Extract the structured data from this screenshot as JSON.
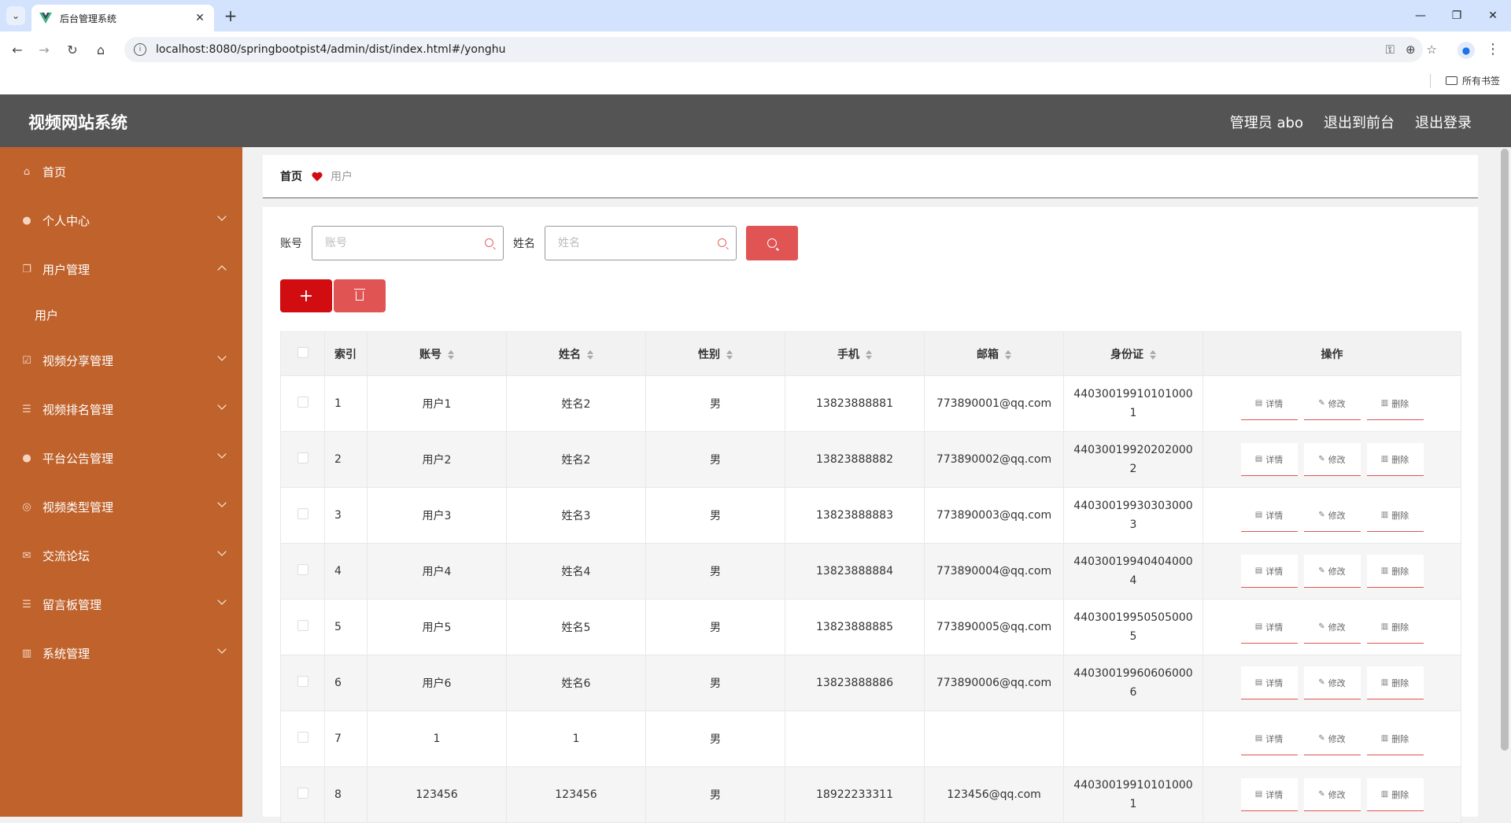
{
  "browser": {
    "tab_title": "后台管理系统",
    "url": "localhost:8080/springbootpist4/admin/dist/index.html#/yonghu",
    "bookmarks_label": "所有书签"
  },
  "header": {
    "title": "视频网站系统",
    "admin_label": "管理员 abo",
    "exit_front_label": "退出到前台",
    "logout_label": "退出登录"
  },
  "sidebar": {
    "items": [
      {
        "label": "首页",
        "icon": "home-icon"
      },
      {
        "label": "个人中心",
        "icon": "user-icon"
      },
      {
        "label": "用户管理",
        "icon": "document-icon"
      },
      {
        "label": "用户",
        "icon": ""
      },
      {
        "label": "视频分享管理",
        "icon": "checkbox-icon"
      },
      {
        "label": "视频排名管理",
        "icon": "list-icon"
      },
      {
        "label": "平台公告管理",
        "icon": "location-icon"
      },
      {
        "label": "视频类型管理",
        "icon": "settings-icon"
      },
      {
        "label": "交流论坛",
        "icon": "mail-icon"
      },
      {
        "label": "留言板管理",
        "icon": "sliders-icon"
      },
      {
        "label": "系统管理",
        "icon": "chart-icon"
      }
    ]
  },
  "breadcrumb": {
    "home": "首页",
    "current": "用户"
  },
  "search": {
    "account_label": "账号",
    "account_placeholder": "账号",
    "name_label": "姓名",
    "name_placeholder": "姓名"
  },
  "table": {
    "headers": [
      "索引",
      "账号",
      "姓名",
      "性别",
      "手机",
      "邮箱",
      "身份证",
      "操作"
    ],
    "op_labels": {
      "detail": "详情",
      "edit": "修改",
      "delete": "删除"
    },
    "rows": [
      {
        "index": "1",
        "account": "用户1",
        "name": "姓名2",
        "gender": "男",
        "phone": "13823888881",
        "email": "773890001@qq.com",
        "idcard": "440300199101010001"
      },
      {
        "index": "2",
        "account": "用户2",
        "name": "姓名2",
        "gender": "男",
        "phone": "13823888882",
        "email": "773890002@qq.com",
        "idcard": "440300199202020002"
      },
      {
        "index": "3",
        "account": "用户3",
        "name": "姓名3",
        "gender": "男",
        "phone": "13823888883",
        "email": "773890003@qq.com",
        "idcard": "440300199303030003"
      },
      {
        "index": "4",
        "account": "用户4",
        "name": "姓名4",
        "gender": "男",
        "phone": "13823888884",
        "email": "773890004@qq.com",
        "idcard": "440300199404040004"
      },
      {
        "index": "5",
        "account": "用户5",
        "name": "姓名5",
        "gender": "男",
        "phone": "13823888885",
        "email": "773890005@qq.com",
        "idcard": "440300199505050005"
      },
      {
        "index": "6",
        "account": "用户6",
        "name": "姓名6",
        "gender": "男",
        "phone": "13823888886",
        "email": "773890006@qq.com",
        "idcard": "440300199606060006"
      },
      {
        "index": "7",
        "account": "1",
        "name": "1",
        "gender": "男",
        "phone": "",
        "email": "",
        "idcard": ""
      },
      {
        "index": "8",
        "account": "123456",
        "name": "123456",
        "gender": "男",
        "phone": "18922233311",
        "email": "123456@qq.com",
        "idcard": "440300199101010001"
      }
    ]
  },
  "colors": {
    "sidebar_bg": "#c0622b",
    "header_bg": "#545454",
    "accent_red": "#d20d12",
    "button_red": "#e05454"
  }
}
